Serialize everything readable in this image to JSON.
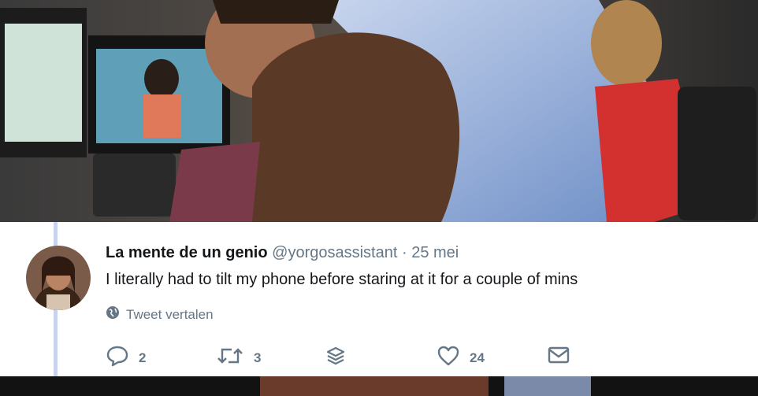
{
  "tweet": {
    "display_name": "La mente de un genio",
    "handle": "@yorgosassistant",
    "separator": "·",
    "date": "25 mei",
    "text": "I literally had to tilt my phone before staring at it for a couple of mins",
    "translate_label": "Tweet vertalen",
    "actions": {
      "reply_count": "2",
      "retweet_count": "3",
      "like_count": "24"
    }
  },
  "icons": {
    "reply": "reply-icon",
    "retweet": "retweet-icon",
    "stack": "stack-icon",
    "like": "heart-icon",
    "dm": "envelope-icon",
    "globe": "globe-icon"
  },
  "colors": {
    "card_bg": "#ffffff",
    "name_text": "#14171a",
    "muted_text": "#657786",
    "thread_line": "#c9d3f0"
  }
}
